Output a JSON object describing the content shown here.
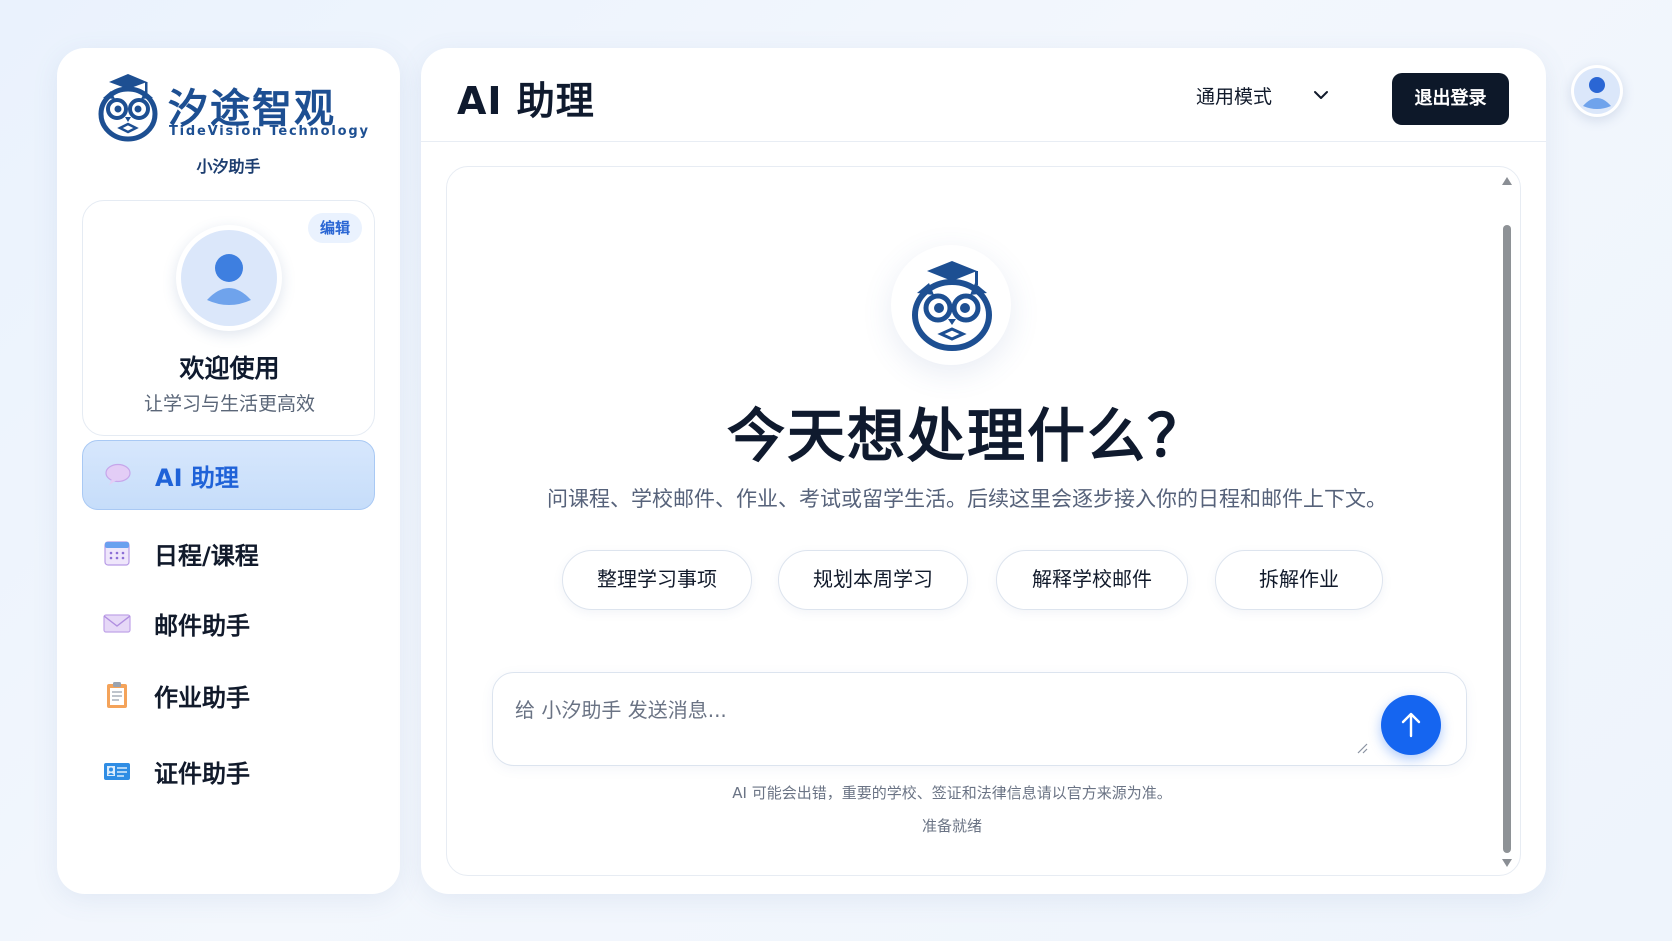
{
  "brand": {
    "name_cn": "汐途智观",
    "name_en": "TideVision Technology",
    "assistant_name": "小汐助手"
  },
  "profile": {
    "edit_label": "编辑",
    "welcome_title": "欢迎使用",
    "welcome_subtitle": "让学习与生活更高效"
  },
  "sidebar": {
    "items": [
      {
        "label": "AI 助理",
        "icon": "chat-bubble-icon",
        "active": true
      },
      {
        "label": "日程/课程",
        "icon": "calendar-icon",
        "active": false
      },
      {
        "label": "邮件助手",
        "icon": "envelope-icon",
        "active": false
      },
      {
        "label": "作业助手",
        "icon": "clipboard-icon",
        "active": false
      },
      {
        "label": "证件助手",
        "icon": "id-card-icon",
        "active": false
      }
    ]
  },
  "header": {
    "title": "AI 助理",
    "mode_label": "通用模式",
    "logout_label": "退出登录"
  },
  "hero": {
    "title": "今天想处理什么？",
    "subtitle": "问课程、学校邮件、作业、考试或留学生活。后续这里会逐步接入你的日程和邮件上下文。"
  },
  "suggestions": [
    "整理学习事项",
    "规划本周学习",
    "解释学校邮件",
    "拆解作业"
  ],
  "composer": {
    "placeholder": "给 小汐助手 发送消息...",
    "value": ""
  },
  "footer": {
    "disclaimer": "AI 可能会出错，重要的学校、签证和法律信息请以官方来源为准。",
    "status": "准备就绪"
  },
  "colors": {
    "accent": "#1565f0",
    "brand_navy": "#1d4f92",
    "dark_button": "#0d1829",
    "active_nav_bg": "#cfe2fb"
  }
}
